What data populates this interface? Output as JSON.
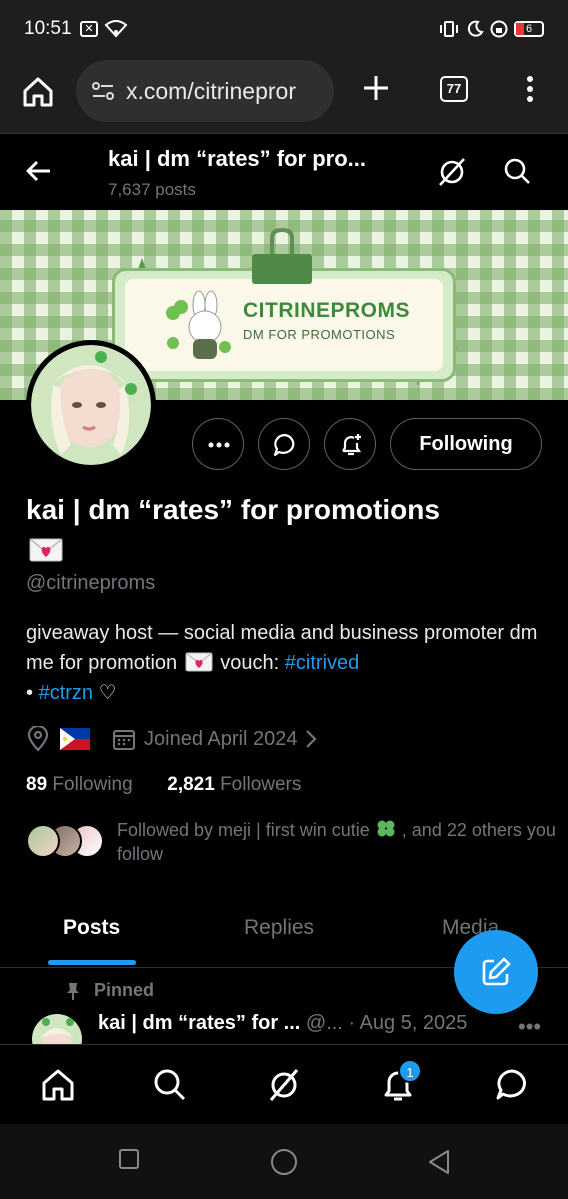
{
  "status_bar": {
    "time": "10:51",
    "battery": "6"
  },
  "browser": {
    "url": "x.com/citrinepror",
    "tab_count": "77"
  },
  "header": {
    "name": "kai | dm “rates” for pro...",
    "posts": "7,637 posts"
  },
  "banner": {
    "title": "CITRINEPROMS",
    "subtitle": "DM FOR PROMOTIONS"
  },
  "actions": {
    "following_label": "Following"
  },
  "profile": {
    "display_name": "kai | dm “rates” for promotions",
    "handle": "@citrineproms",
    "bio_text": "giveaway host — social media and business promoter dm me for promotion",
    "bio_vouch": "vouch:",
    "bio_link1": "#citrived",
    "bio_sep": "•",
    "bio_link2": "#ctrzn",
    "bio_heart": "♡",
    "joined": "Joined April 2024",
    "following_count": "89",
    "following_label": "Following",
    "followers_count": "2,821",
    "followers_label": "Followers",
    "followed_by_prefix": "Followed by meji | first win cutie",
    "followed_by_suffix": ", and 22 others you follow"
  },
  "tabs": [
    {
      "label": "Posts"
    },
    {
      "label": "Replies"
    },
    {
      "label": "Media"
    }
  ],
  "tweet": {
    "pinned_label": "Pinned",
    "author": "kai | dm “rates” for ...",
    "handle": "@...",
    "date": "· Aug 5, 2025",
    "more": "•••"
  },
  "bottom_nav": {
    "notification_badge": "1"
  },
  "colors": {
    "accent": "#1d9bf0",
    "muted": "#71767b",
    "banner_green": "#3d8a3a"
  }
}
